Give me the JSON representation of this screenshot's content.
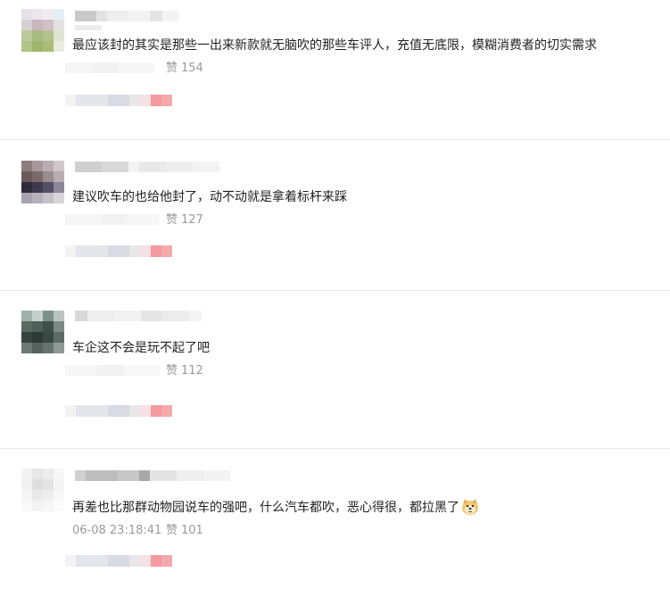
{
  "comments": [
    {
      "text": "最应该封的其实是那些一出来新款就无脑吹的那些车评人，充值无底限，模糊消费者的切实需求",
      "likes_label": "赞",
      "likes": "154",
      "timestamp": ""
    },
    {
      "text": "建议吹车的也给他封了，动不动就是拿着标杆来踩",
      "likes_label": "赞",
      "likes": "127",
      "timestamp": ""
    },
    {
      "text": "车企这不会是玩不起了吧",
      "likes_label": "赞",
      "likes": "112",
      "timestamp": ""
    },
    {
      "text": "再差也比那群动物园说车的强吧，什么汽车都吹，恶心得很，都拉黑了",
      "likes_label": "赞",
      "likes": "101",
      "timestamp": "06-08 23:18:41",
      "emoji": "doge-emoji"
    }
  ],
  "colors": {
    "divider": "#e8e8e8",
    "text": "#222222",
    "meta": "#9a9a9a",
    "like_button": "#f59a9f"
  }
}
